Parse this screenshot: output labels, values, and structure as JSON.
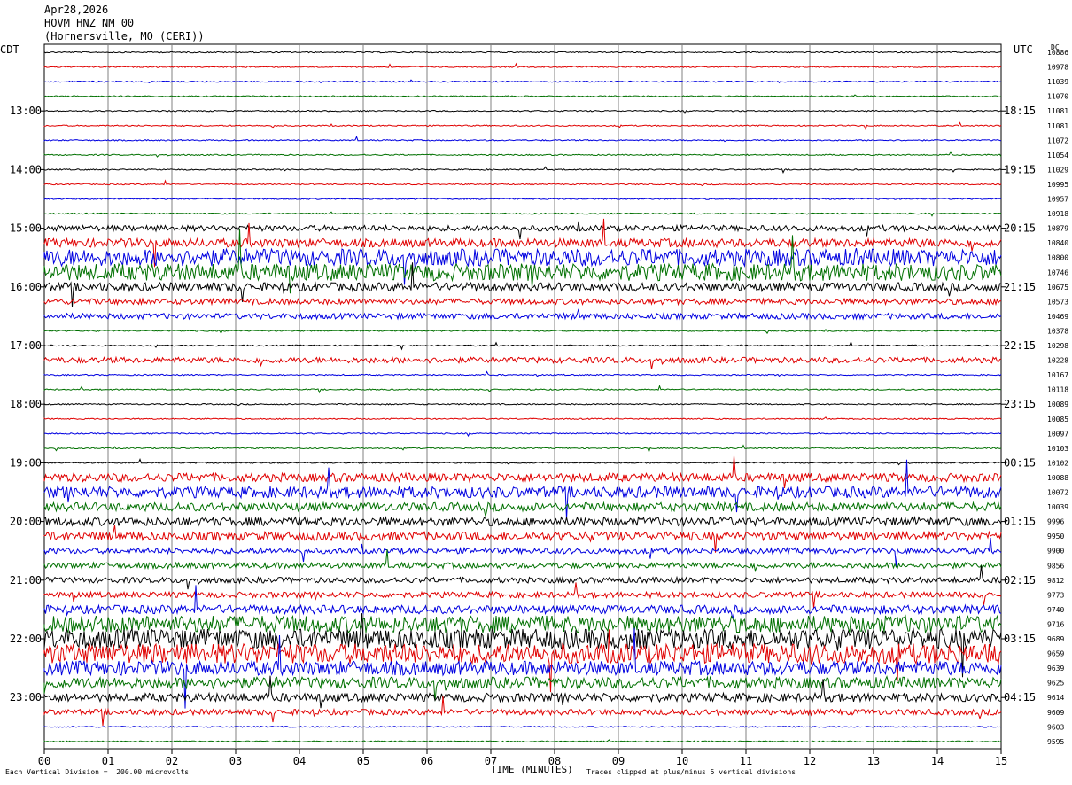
{
  "header": {
    "date": "Apr28,2026",
    "station": "HOVM HNZ NM 00",
    "location": "(Hornersville, MO (CERI))"
  },
  "tz_left": "CDT",
  "tz_right": "UTC",
  "dc_label": "DC",
  "footer": {
    "scale_note": "Each Vertical Division =  200.00 microvolts",
    "clip_note": "Traces clipped at plus/minus 5 vertical divisions"
  },
  "colors": {
    "trace_cycle": [
      "#000000",
      "#e00000",
      "#0000e0",
      "#007000"
    ],
    "grid": "#808080"
  },
  "chart_data": {
    "type": "line",
    "xlabel": "TIME (MINUTES)",
    "xlim": [
      0,
      15
    ],
    "x_ticks": [
      "00",
      "01",
      "02",
      "03",
      "04",
      "05",
      "06",
      "07",
      "08",
      "09",
      "10",
      "11",
      "12",
      "13",
      "14",
      "15"
    ],
    "left_time_labels": [
      "13:00",
      "14:00",
      "15:00",
      "16:00",
      "17:00",
      "18:00",
      "19:00",
      "20:00",
      "21:00",
      "22:00",
      "23:00"
    ],
    "right_time_labels": [
      "18:15",
      "19:15",
      "20:15",
      "21:15",
      "22:15",
      "23:15",
      "00:15",
      "01:15",
      "02:15",
      "03:15",
      "04:15"
    ],
    "traces_per_label": 4,
    "dc_offsets": [
      10886,
      10978,
      11039,
      11070,
      11081,
      11081,
      11072,
      11054,
      11029,
      10995,
      10957,
      10918,
      10879,
      10840,
      10800,
      10746,
      10675,
      10573,
      10469,
      10378,
      10298,
      10228,
      10167,
      10118,
      10089,
      10085,
      10097,
      10103,
      10102,
      10088,
      10072,
      10039,
      9996,
      9950,
      9900,
      9856,
      9812,
      9773,
      9740,
      9716,
      9689,
      9659,
      9639,
      9625,
      9614,
      9609,
      9603,
      9595
    ],
    "trace_noise_level": [
      1,
      1,
      1,
      1,
      1,
      1,
      1,
      1,
      1,
      1,
      1,
      1,
      2,
      3,
      6,
      6,
      3,
      2,
      2,
      1,
      1,
      2,
      1,
      1,
      1,
      1,
      1,
      1,
      1,
      3,
      4,
      3,
      3,
      3,
      2,
      2,
      2,
      2,
      3,
      6,
      7,
      7,
      5,
      4,
      3,
      2,
      1,
      1
    ]
  }
}
